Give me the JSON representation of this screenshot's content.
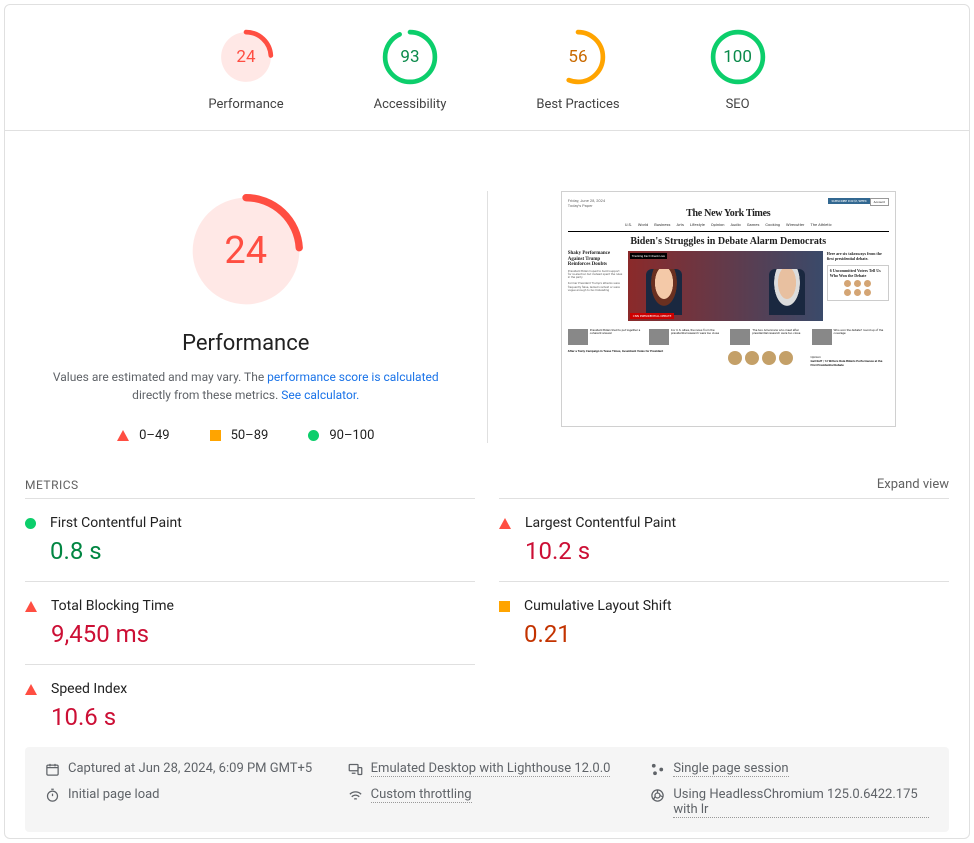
{
  "gauges": [
    {
      "label": "Performance",
      "score": "24",
      "pct": 24,
      "status": "fail"
    },
    {
      "label": "Accessibility",
      "score": "93",
      "pct": 93,
      "status": "pass"
    },
    {
      "label": "Best Practices",
      "score": "56",
      "pct": 56,
      "status": "avg"
    },
    {
      "label": "SEO",
      "score": "100",
      "pct": 100,
      "status": "pass"
    }
  ],
  "performance": {
    "title": "Performance",
    "score": "24",
    "pct": 24,
    "desc_prefix": "Values are estimated and may vary. The ",
    "link1": "performance score is calculated",
    "desc_mid": " directly from these metrics. ",
    "link2": "See calculator."
  },
  "legend": {
    "fail": "0–49",
    "avg": "50–89",
    "pass": "90–100"
  },
  "metrics_header": {
    "title": "METRICS",
    "expand": "Expand view"
  },
  "metrics": [
    {
      "name": "First Contentful Paint",
      "value": "0.8 s",
      "status": "pass",
      "valclass": "val-green"
    },
    {
      "name": "Largest Contentful Paint",
      "value": "10.2 s",
      "status": "fail",
      "valclass": "val-red"
    },
    {
      "name": "Total Blocking Time",
      "value": "9,450 ms",
      "status": "fail",
      "valclass": "val-red"
    },
    {
      "name": "Cumulative Layout Shift",
      "value": "0.21",
      "status": "avg",
      "valclass": "val-orange"
    },
    {
      "name": "Speed Index",
      "value": "10.6 s",
      "status": "fail",
      "valclass": "val-red"
    }
  ],
  "footer": {
    "captured": "Captured at Jun 28, 2024, 6:09 PM GMT+5",
    "emulated": "Emulated Desktop with Lighthouse 12.0.0",
    "session": "Single page session",
    "initial": "Initial page load",
    "throttling": "Custom throttling",
    "chromium": "Using HeadlessChromium 125.0.6422.175 with lr"
  },
  "screenshot": {
    "logo": "The New York Times",
    "date": "Friday, June 28, 2024",
    "paper": "Today's Paper",
    "nav": [
      "U.S.",
      "World",
      "Business",
      "Arts",
      "Lifestyle",
      "Opinion",
      "Audio",
      "Games",
      "Cooking",
      "Wirecutter",
      "The Athletic"
    ],
    "headline": "Biden's Struggles in Debate Alarm Democrats",
    "sub1": "Shaky Performance Against Trump Reinforces Doubts",
    "sidehead": "Here are six takeaways from the first presidential debate.",
    "votebox": "6 Uncommitted Voters Tell Us Who Won the Debate",
    "subscribe": "SUBSCRIBE FOR $1/WEEK",
    "account": "Account",
    "opinion": "Opinion",
    "opname": "Gail Roff | 12 Writers Rate Biden's Performance at the First Presidential Debate"
  }
}
